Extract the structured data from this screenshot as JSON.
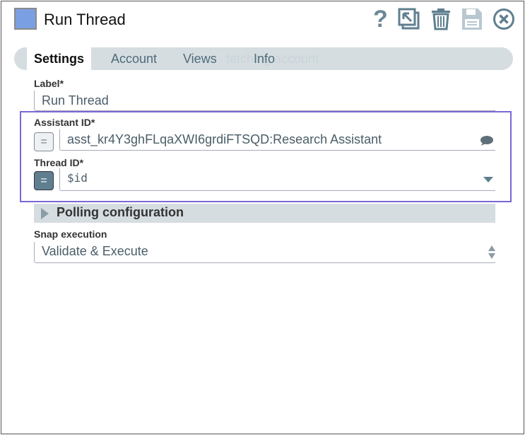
{
  "header": {
    "title": "Run Thread",
    "swatch_color": "#7b9fe3",
    "icons": [
      "help-icon",
      "export-icon",
      "trash-icon",
      "save-icon",
      "close-icon"
    ]
  },
  "tabs": [
    {
      "label": "Settings",
      "active": true
    },
    {
      "label": "Account"
    },
    {
      "label": "Views"
    },
    {
      "label": "Info"
    }
  ],
  "ghost_text": "fetching account",
  "form": {
    "label": {
      "label": "Label*",
      "value": "Run Thread"
    },
    "assistant_id": {
      "label": "Assistant ID*",
      "value": "asst_kr4Y3ghFLqaXWI6grdiFTSQD:Research Assistant",
      "expression": false
    },
    "thread_id": {
      "label": "Thread ID*",
      "value": "$id",
      "expression": true
    },
    "polling": {
      "label": "Polling configuration"
    },
    "snap_execution": {
      "label": "Snap execution",
      "value": "Validate & Execute"
    }
  },
  "highlight_color": "#7b68d6"
}
